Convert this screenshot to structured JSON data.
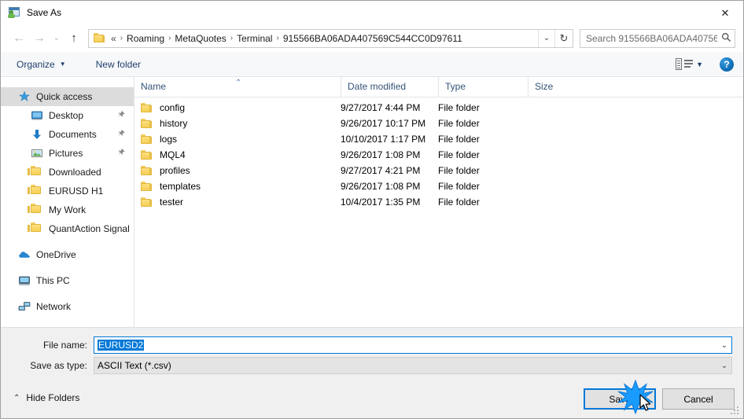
{
  "window": {
    "title": "Save As",
    "icon": "save-as-dialog-icon",
    "close_label": "✕"
  },
  "navigation": {
    "back_icon": "←",
    "forward_icon": "→",
    "recent_icon": "⌄",
    "up_icon": "↑",
    "breadcrumb_lead": "«",
    "breadcrumbs": [
      "Roaming",
      "MetaQuotes",
      "Terminal",
      "915566BA06ADA407569C544CC0D97611"
    ],
    "separator": "›",
    "dropdown_icon": "⌄",
    "refresh_icon": "↻"
  },
  "search": {
    "placeholder": "Search 915566BA06ADA40756...",
    "icon": "🔍"
  },
  "toolbar": {
    "organize_label": "Organize",
    "organize_caret": "▼",
    "new_folder_label": "New folder",
    "view_caret": "▼",
    "help_label": "?"
  },
  "sidebar": {
    "items": [
      {
        "label": "Quick access",
        "icon": "star-icon",
        "level": 0,
        "selected": true,
        "pinned": false
      },
      {
        "label": "Desktop",
        "icon": "monitor-icon",
        "level": 1,
        "selected": false,
        "pinned": true
      },
      {
        "label": "Documents",
        "icon": "download-arrow-icon",
        "level": 1,
        "selected": false,
        "pinned": true
      },
      {
        "label": "Pictures",
        "icon": "picture-icon",
        "level": 1,
        "selected": false,
        "pinned": true
      },
      {
        "label": "Downloaded",
        "icon": "folder-icon",
        "level": 1,
        "selected": false,
        "pinned": false
      },
      {
        "label": "EURUSD H1",
        "icon": "folder-icon",
        "level": 1,
        "selected": false,
        "pinned": false
      },
      {
        "label": "My Work",
        "icon": "folder-icon",
        "level": 1,
        "selected": false,
        "pinned": false
      },
      {
        "label": "QuantAction Signal",
        "icon": "folder-icon",
        "level": 1,
        "selected": false,
        "pinned": false
      },
      {
        "label": "OneDrive",
        "icon": "cloud-icon",
        "level": 0,
        "selected": false,
        "pinned": false,
        "gap_before": true
      },
      {
        "label": "This PC",
        "icon": "pc-icon",
        "level": 0,
        "selected": false,
        "pinned": false,
        "gap_before": true
      },
      {
        "label": "Network",
        "icon": "network-icon",
        "level": 0,
        "selected": false,
        "pinned": false,
        "gap_before": true
      }
    ],
    "pin_icon": "📌"
  },
  "filelist": {
    "columns": [
      "Name",
      "Date modified",
      "Type",
      "Size"
    ],
    "sort_indicator": "⌃",
    "rows": [
      {
        "name": "config",
        "date": "9/27/2017 4:44 PM",
        "type": "File folder",
        "size": ""
      },
      {
        "name": "history",
        "date": "9/26/2017 10:17 PM",
        "type": "File folder",
        "size": ""
      },
      {
        "name": "logs",
        "date": "10/10/2017 1:17 PM",
        "type": "File folder",
        "size": ""
      },
      {
        "name": "MQL4",
        "date": "9/26/2017 1:08 PM",
        "type": "File folder",
        "size": ""
      },
      {
        "name": "profiles",
        "date": "9/27/2017 4:21 PM",
        "type": "File folder",
        "size": ""
      },
      {
        "name": "templates",
        "date": "9/26/2017 1:08 PM",
        "type": "File folder",
        "size": ""
      },
      {
        "name": "tester",
        "date": "10/4/2017 1:35 PM",
        "type": "File folder",
        "size": ""
      }
    ]
  },
  "form": {
    "filename_label": "File name:",
    "filename_value": "EURUSD2",
    "filename_selected": true,
    "filetype_label": "Save as type:",
    "filetype_value": "ASCII Text (*.csv)",
    "dropdown_icon": "⌄"
  },
  "footer": {
    "hide_folders_label": "Hide Folders",
    "hide_folders_chevron": "⌃",
    "save_label": "Save",
    "cancel_label": "Cancel"
  },
  "colors": {
    "accent": "#0078d7",
    "selection": "#0078d7",
    "toolbar_text": "#1f3f6b",
    "column_header_text": "#35537a",
    "sidebar_selected_bg": "#dcdcdc",
    "panel_bg": "#f0f0f0",
    "folder_yellow": "#f6cf55"
  }
}
